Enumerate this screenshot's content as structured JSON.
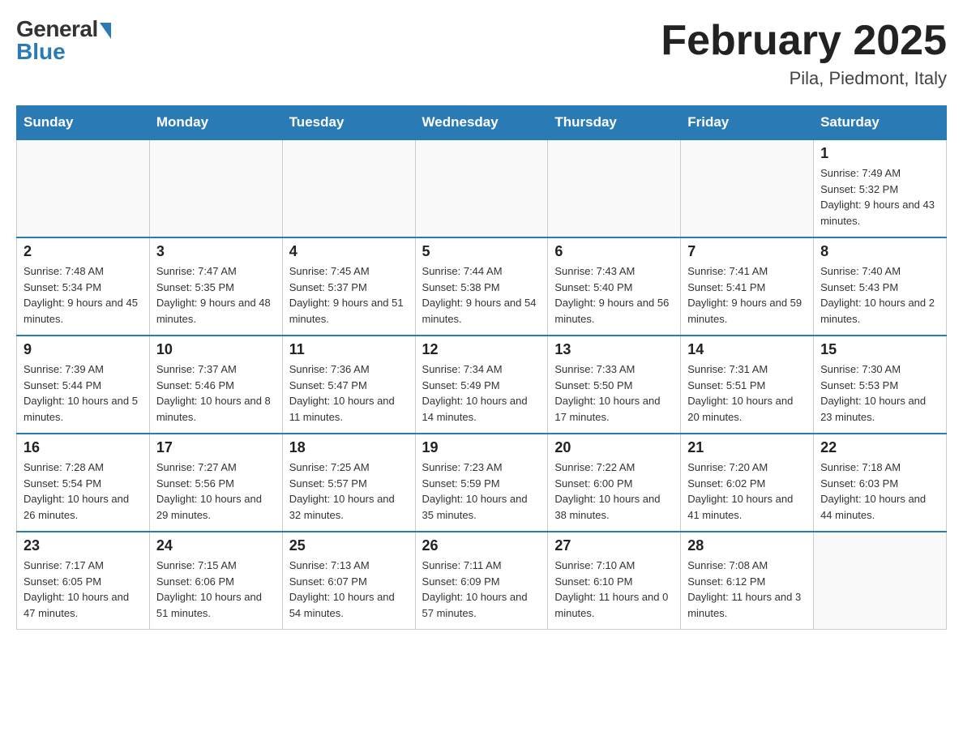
{
  "header": {
    "logo_general": "General",
    "logo_blue": "Blue",
    "title": "February 2025",
    "location": "Pila, Piedmont, Italy"
  },
  "days_of_week": [
    "Sunday",
    "Monday",
    "Tuesday",
    "Wednesday",
    "Thursday",
    "Friday",
    "Saturday"
  ],
  "weeks": [
    {
      "days": [
        {
          "number": "",
          "info": "",
          "empty": true
        },
        {
          "number": "",
          "info": "",
          "empty": true
        },
        {
          "number": "",
          "info": "",
          "empty": true
        },
        {
          "number": "",
          "info": "",
          "empty": true
        },
        {
          "number": "",
          "info": "",
          "empty": true
        },
        {
          "number": "",
          "info": "",
          "empty": true
        },
        {
          "number": "1",
          "info": "Sunrise: 7:49 AM\nSunset: 5:32 PM\nDaylight: 9 hours and 43 minutes.",
          "empty": false
        }
      ]
    },
    {
      "days": [
        {
          "number": "2",
          "info": "Sunrise: 7:48 AM\nSunset: 5:34 PM\nDaylight: 9 hours and 45 minutes.",
          "empty": false
        },
        {
          "number": "3",
          "info": "Sunrise: 7:47 AM\nSunset: 5:35 PM\nDaylight: 9 hours and 48 minutes.",
          "empty": false
        },
        {
          "number": "4",
          "info": "Sunrise: 7:45 AM\nSunset: 5:37 PM\nDaylight: 9 hours and 51 minutes.",
          "empty": false
        },
        {
          "number": "5",
          "info": "Sunrise: 7:44 AM\nSunset: 5:38 PM\nDaylight: 9 hours and 54 minutes.",
          "empty": false
        },
        {
          "number": "6",
          "info": "Sunrise: 7:43 AM\nSunset: 5:40 PM\nDaylight: 9 hours and 56 minutes.",
          "empty": false
        },
        {
          "number": "7",
          "info": "Sunrise: 7:41 AM\nSunset: 5:41 PM\nDaylight: 9 hours and 59 minutes.",
          "empty": false
        },
        {
          "number": "8",
          "info": "Sunrise: 7:40 AM\nSunset: 5:43 PM\nDaylight: 10 hours and 2 minutes.",
          "empty": false
        }
      ]
    },
    {
      "days": [
        {
          "number": "9",
          "info": "Sunrise: 7:39 AM\nSunset: 5:44 PM\nDaylight: 10 hours and 5 minutes.",
          "empty": false
        },
        {
          "number": "10",
          "info": "Sunrise: 7:37 AM\nSunset: 5:46 PM\nDaylight: 10 hours and 8 minutes.",
          "empty": false
        },
        {
          "number": "11",
          "info": "Sunrise: 7:36 AM\nSunset: 5:47 PM\nDaylight: 10 hours and 11 minutes.",
          "empty": false
        },
        {
          "number": "12",
          "info": "Sunrise: 7:34 AM\nSunset: 5:49 PM\nDaylight: 10 hours and 14 minutes.",
          "empty": false
        },
        {
          "number": "13",
          "info": "Sunrise: 7:33 AM\nSunset: 5:50 PM\nDaylight: 10 hours and 17 minutes.",
          "empty": false
        },
        {
          "number": "14",
          "info": "Sunrise: 7:31 AM\nSunset: 5:51 PM\nDaylight: 10 hours and 20 minutes.",
          "empty": false
        },
        {
          "number": "15",
          "info": "Sunrise: 7:30 AM\nSunset: 5:53 PM\nDaylight: 10 hours and 23 minutes.",
          "empty": false
        }
      ]
    },
    {
      "days": [
        {
          "number": "16",
          "info": "Sunrise: 7:28 AM\nSunset: 5:54 PM\nDaylight: 10 hours and 26 minutes.",
          "empty": false
        },
        {
          "number": "17",
          "info": "Sunrise: 7:27 AM\nSunset: 5:56 PM\nDaylight: 10 hours and 29 minutes.",
          "empty": false
        },
        {
          "number": "18",
          "info": "Sunrise: 7:25 AM\nSunset: 5:57 PM\nDaylight: 10 hours and 32 minutes.",
          "empty": false
        },
        {
          "number": "19",
          "info": "Sunrise: 7:23 AM\nSunset: 5:59 PM\nDaylight: 10 hours and 35 minutes.",
          "empty": false
        },
        {
          "number": "20",
          "info": "Sunrise: 7:22 AM\nSunset: 6:00 PM\nDaylight: 10 hours and 38 minutes.",
          "empty": false
        },
        {
          "number": "21",
          "info": "Sunrise: 7:20 AM\nSunset: 6:02 PM\nDaylight: 10 hours and 41 minutes.",
          "empty": false
        },
        {
          "number": "22",
          "info": "Sunrise: 7:18 AM\nSunset: 6:03 PM\nDaylight: 10 hours and 44 minutes.",
          "empty": false
        }
      ]
    },
    {
      "days": [
        {
          "number": "23",
          "info": "Sunrise: 7:17 AM\nSunset: 6:05 PM\nDaylight: 10 hours and 47 minutes.",
          "empty": false
        },
        {
          "number": "24",
          "info": "Sunrise: 7:15 AM\nSunset: 6:06 PM\nDaylight: 10 hours and 51 minutes.",
          "empty": false
        },
        {
          "number": "25",
          "info": "Sunrise: 7:13 AM\nSunset: 6:07 PM\nDaylight: 10 hours and 54 minutes.",
          "empty": false
        },
        {
          "number": "26",
          "info": "Sunrise: 7:11 AM\nSunset: 6:09 PM\nDaylight: 10 hours and 57 minutes.",
          "empty": false
        },
        {
          "number": "27",
          "info": "Sunrise: 7:10 AM\nSunset: 6:10 PM\nDaylight: 11 hours and 0 minutes.",
          "empty": false
        },
        {
          "number": "28",
          "info": "Sunrise: 7:08 AM\nSunset: 6:12 PM\nDaylight: 11 hours and 3 minutes.",
          "empty": false
        },
        {
          "number": "",
          "info": "",
          "empty": true
        }
      ]
    }
  ]
}
